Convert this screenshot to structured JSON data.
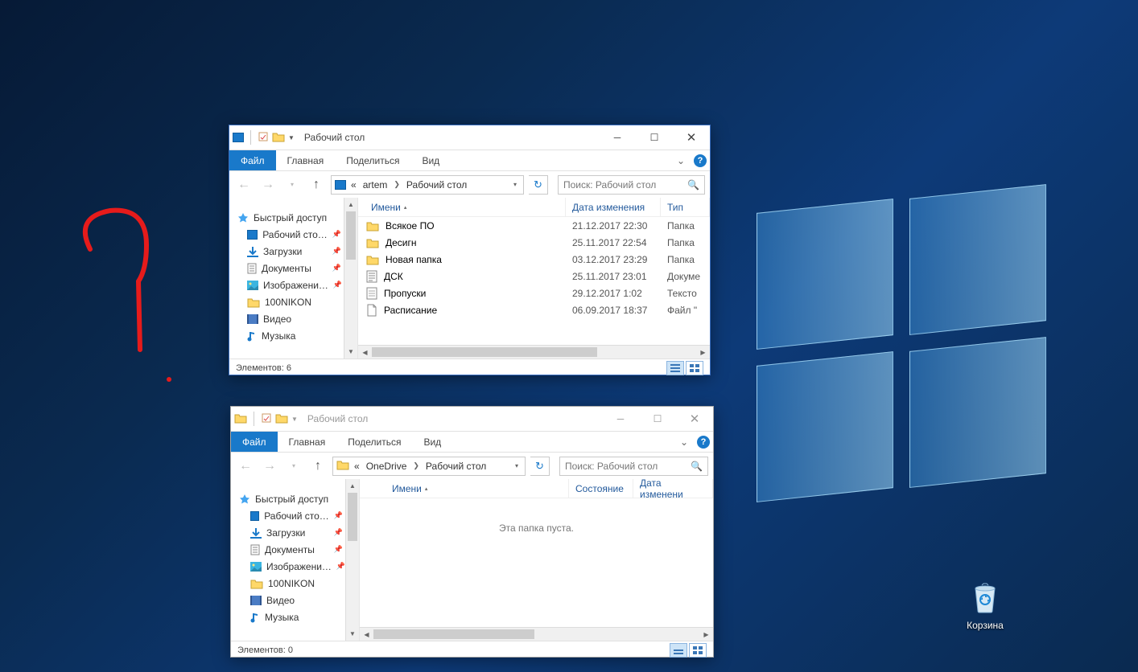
{
  "desktop": {
    "recycle_bin": "Корзина"
  },
  "window1": {
    "title": "Рабочий стол",
    "tabs": {
      "file": "Файл",
      "home": "Главная",
      "share": "Поделиться",
      "view": "Вид"
    },
    "breadcrumb_prefix": "«",
    "breadcrumb": [
      "artem",
      "Рабочий стол"
    ],
    "search_placeholder": "Поиск: Рабочий стол",
    "sidebar": {
      "quick_access": "Быстрый доступ",
      "items": [
        {
          "label": "Рабочий сто…",
          "icon": "desktop",
          "pinned": true
        },
        {
          "label": "Загрузки",
          "icon": "downloads",
          "pinned": true
        },
        {
          "label": "Документы",
          "icon": "documents",
          "pinned": true
        },
        {
          "label": "Изображени…",
          "icon": "pictures",
          "pinned": true
        },
        {
          "label": "100NIKON",
          "icon": "folder",
          "pinned": false
        },
        {
          "label": "Видео",
          "icon": "video",
          "pinned": false
        },
        {
          "label": "Музыка",
          "icon": "music",
          "pinned": false
        }
      ]
    },
    "columns": {
      "name": "Имени",
      "date": "Дата изменения",
      "type": "Тип"
    },
    "files": [
      {
        "name": "Всякое ПО",
        "date": "21.12.2017 22:30",
        "type": "Папка",
        "icon": "folder"
      },
      {
        "name": "Десигн",
        "date": "25.11.2017 22:54",
        "type": "Папка",
        "icon": "folder"
      },
      {
        "name": "Новая папка",
        "date": "03.12.2017 23:29",
        "type": "Папка",
        "icon": "folder"
      },
      {
        "name": "ДСК",
        "date": "25.11.2017 23:01",
        "type": "Докуме",
        "icon": "docx"
      },
      {
        "name": "Пропуски",
        "date": "29.12.2017 1:02",
        "type": "Тексто",
        "icon": "txt"
      },
      {
        "name": "Расписание",
        "date": "06.09.2017 18:37",
        "type": "Файл \"",
        "icon": "file"
      }
    ],
    "status": "Элементов: 6"
  },
  "window2": {
    "title": "Рабочий стол",
    "tabs": {
      "file": "Файл",
      "home": "Главная",
      "share": "Поделиться",
      "view": "Вид"
    },
    "breadcrumb_prefix": "«",
    "breadcrumb": [
      "OneDrive",
      "Рабочий стол"
    ],
    "search_placeholder": "Поиск: Рабочий стол",
    "sidebar": {
      "quick_access": "Быстрый доступ",
      "items": [
        {
          "label": "Рабочий сто…",
          "icon": "desktop",
          "pinned": true
        },
        {
          "label": "Загрузки",
          "icon": "downloads",
          "pinned": true
        },
        {
          "label": "Документы",
          "icon": "documents",
          "pinned": true
        },
        {
          "label": "Изображени…",
          "icon": "pictures",
          "pinned": true
        },
        {
          "label": "100NIKON",
          "icon": "folder",
          "pinned": false
        },
        {
          "label": "Видео",
          "icon": "video",
          "pinned": false
        },
        {
          "label": "Музыка",
          "icon": "music",
          "pinned": false
        }
      ]
    },
    "columns": {
      "name": "Имени",
      "state": "Состояние",
      "date": "Дата изменени"
    },
    "empty": "Эта папка пуста.",
    "status": "Элементов: 0"
  }
}
